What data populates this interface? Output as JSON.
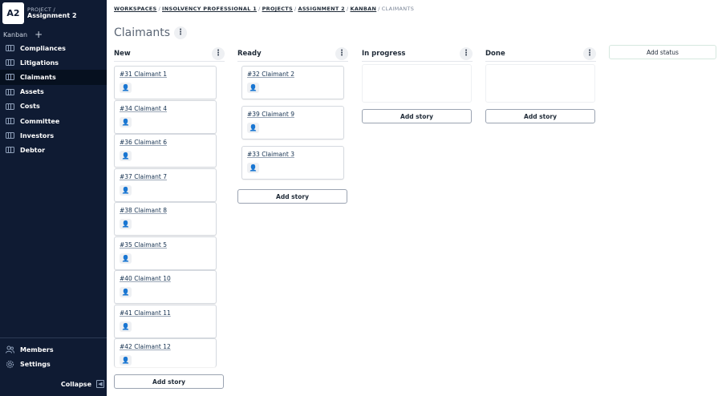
{
  "project": {
    "badge": "A2",
    "supertitle": "PROJECT /",
    "name": "Assignment 2"
  },
  "kanban_label": "Kanban",
  "sidebar": {
    "items": [
      {
        "label": "Compliances",
        "active": false
      },
      {
        "label": "Litigations",
        "active": false
      },
      {
        "label": "Claimants",
        "active": true
      },
      {
        "label": "Assets",
        "active": false
      },
      {
        "label": "Costs",
        "active": false
      },
      {
        "label": "Committee",
        "active": false
      },
      {
        "label": "Investors",
        "active": false
      },
      {
        "label": "Debtor",
        "active": false
      }
    ],
    "bottom": [
      {
        "label": "Members",
        "icon": "members-icon"
      },
      {
        "label": "Settings",
        "icon": "gear-icon"
      }
    ],
    "collapse_label": "Collapse"
  },
  "breadcrumb": [
    "WORKSPACES",
    "INSOLVENCY PROFESSIONAL 1",
    "PROJECTS",
    "ASSIGNMENT 2",
    "KANBAN",
    "CLAIMANTS"
  ],
  "page_title": "Claimants",
  "add_status_label": "Add status",
  "add_story_label": "Add story",
  "columns": [
    {
      "title": "New",
      "cards": [
        "#31 Claimant 1",
        "#34 Claimant 4",
        "#36 Claimant 6",
        "#37 Claimant 7",
        "#38 Claimant 8",
        "#35 Claimant 5",
        "#40 Claimant 10",
        "#41 Claimant 11",
        "#42 Claimant 12"
      ]
    },
    {
      "title": "Ready",
      "cards": [
        "#32 Claimant 2",
        "#39 Claimant 9",
        "#33 Claimant 3"
      ]
    },
    {
      "title": "In progress",
      "cards": []
    },
    {
      "title": "Done",
      "cards": []
    }
  ]
}
